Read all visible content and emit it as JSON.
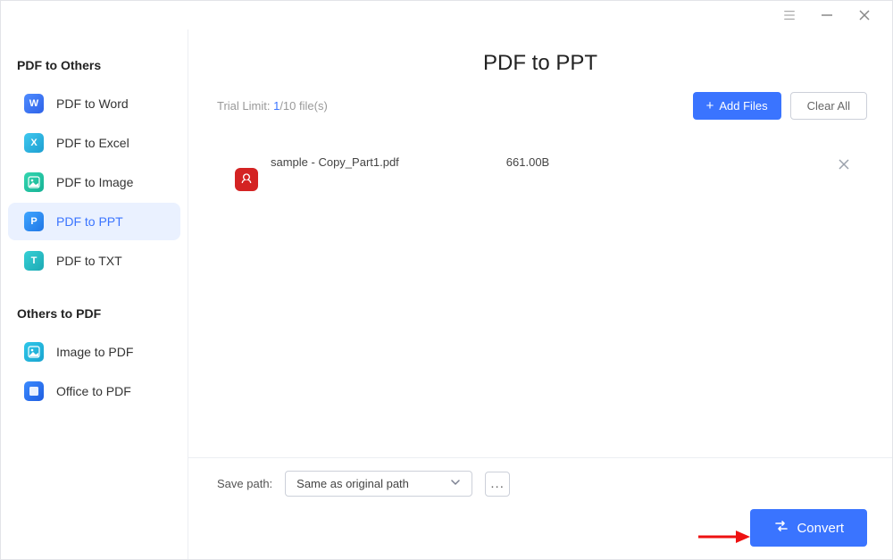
{
  "sidebar": {
    "section1_label": "PDF to Others",
    "section2_label": "Others to PDF",
    "items1": [
      {
        "label": "PDF to Word",
        "icon_letter": "W"
      },
      {
        "label": "PDF to Excel",
        "icon_letter": "X"
      },
      {
        "label": "PDF to Image",
        "icon_letter": ""
      },
      {
        "label": "PDF to PPT",
        "icon_letter": "P"
      },
      {
        "label": "PDF to TXT",
        "icon_letter": "T"
      }
    ],
    "items2": [
      {
        "label": "Image to PDF",
        "icon_letter": ""
      },
      {
        "label": "Office to PDF",
        "icon_letter": ""
      }
    ]
  },
  "header": {
    "title": "PDF to PPT"
  },
  "toolbar": {
    "trial_label": "Trial Limit: ",
    "trial_count": "1",
    "trial_total": "/10 file(s)",
    "add_files_label": "Add Files",
    "clear_all_label": "Clear All"
  },
  "files": [
    {
      "name": "sample - Copy_Part1.pdf",
      "size": "661.00B"
    }
  ],
  "bottom": {
    "save_path_label": "Save path:",
    "save_path_value": "Same as original path",
    "browse_label": "...",
    "convert_label": "Convert"
  }
}
